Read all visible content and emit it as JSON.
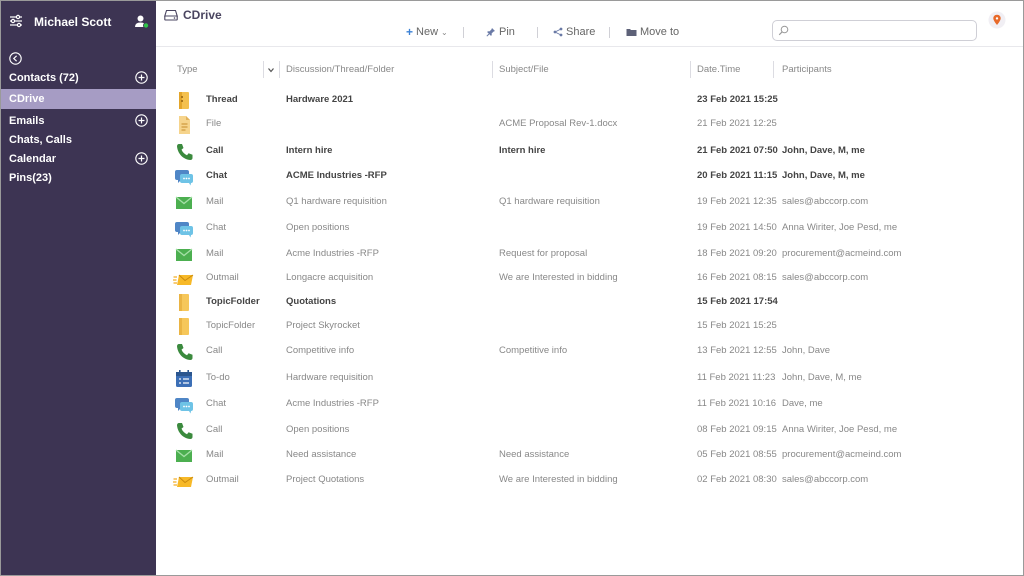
{
  "user": {
    "name": "Michael Scott"
  },
  "icons": {
    "settings": "settings-sliders-icon",
    "contact": "contact-status-icon",
    "back": "back-circle-icon",
    "add": "add-circle-icon",
    "drive": "drive-icon",
    "search": "search-icon"
  },
  "colors": {
    "sidebar_bg": "#3d3453",
    "sidebar_active": "#a69cc4",
    "status_online": "#2fc44a",
    "badge": "#e86a2a"
  },
  "sidebar": {
    "items": [
      {
        "label": "Contacts (72)",
        "add": true,
        "active": false
      },
      {
        "label": "CDrive",
        "add": false,
        "active": true
      },
      {
        "label": "Emails",
        "add": true,
        "active": false
      },
      {
        "label": "Chats, Calls",
        "add": false,
        "active": false
      },
      {
        "label": "Calendar",
        "add": true,
        "active": false
      },
      {
        "label": "Pins(23)",
        "add": false,
        "active": false
      }
    ]
  },
  "header": {
    "title": "CDrive",
    "toolbar": {
      "new": "New",
      "pin": "Pin",
      "share": "Share",
      "move": "Move to"
    },
    "search_placeholder": ""
  },
  "table": {
    "columns": {
      "type": "Type",
      "discussion": "Discussion/Thread/Folder",
      "subject": "Subject/File",
      "datetime": "Date.Time",
      "participants": "Participants"
    },
    "rows": [
      {
        "icon": "thread-folder-icon",
        "type": "Thread",
        "discussion": "Hardware 2021",
        "subject": "",
        "date": "23 Feb 2021 15:25",
        "participants": "",
        "bold": true
      },
      {
        "icon": "file-icon",
        "type": "File",
        "discussion": "",
        "subject": "ACME Proposal Rev-1.docx",
        "date": "21 Feb 2021 12:25",
        "participants": "",
        "bold": false
      },
      {
        "icon": "phone-icon",
        "type": "Call",
        "discussion": "Intern hire",
        "subject": "Intern hire",
        "date": "21 Feb 2021 07:50",
        "participants": "John, Dave, M, me",
        "bold": true
      },
      {
        "icon": "chat-icon",
        "type": "Chat",
        "discussion": "ACME Industries -RFP",
        "subject": "",
        "date": "20 Feb 2021 11:15",
        "participants": "John, Dave, M, me",
        "bold": true
      },
      {
        "icon": "mail-icon",
        "type": "Mail",
        "discussion": "Q1 hardware  requisition",
        "subject": "Q1 hardware  requisition",
        "date": "19 Feb 2021 12:35",
        "participants": "sales@abccorp.com",
        "bold": false
      },
      {
        "icon": "chat-icon",
        "type": "Chat",
        "discussion": "Open positions",
        "subject": "",
        "date": "19 Feb 2021 14:50",
        "participants": "Anna Wiriter, Joe Pesd, me",
        "bold": false
      },
      {
        "icon": "mail-icon",
        "type": "Mail",
        "discussion": "Acme Industries -RFP",
        "subject": "Request for proposal",
        "date": "18 Feb 2021 09:20",
        "participants": "procurement@acmeind.com",
        "bold": false
      },
      {
        "icon": "outmail-icon",
        "type": "Outmail",
        "discussion": "Longacre acquisition",
        "subject": "We are Interested in bidding",
        "date": "16 Feb 2021 08:15",
        "participants": "sales@abccorp.com",
        "bold": false
      },
      {
        "icon": "folder-icon",
        "type": "TopicFolder",
        "discussion": "Quotations",
        "subject": "",
        "date": "15 Feb 2021 17:54",
        "participants": "",
        "bold": true
      },
      {
        "icon": "folder-icon",
        "type": "TopicFolder",
        "discussion": "Project Skyrocket",
        "subject": "",
        "date": "15 Feb 2021 15:25",
        "participants": "",
        "bold": false
      },
      {
        "icon": "phone-icon",
        "type": "Call",
        "discussion": "Competitive info",
        "subject": "Competitive info",
        "date": "13 Feb 2021 12:55",
        "participants": "John, Dave",
        "bold": false
      },
      {
        "icon": "todo-icon",
        "type": "To-do",
        "discussion": "Hardware  requisition",
        "subject": "",
        "date": "11 Feb 2021 11:23",
        "participants": "John, Dave, M, me",
        "bold": false
      },
      {
        "icon": "chat-icon",
        "type": "Chat",
        "discussion": "Acme Industries -RFP",
        "subject": "",
        "date": "11 Feb 2021 10:16",
        "participants": "Dave, me",
        "bold": false
      },
      {
        "icon": "phone-icon",
        "type": "Call",
        "discussion": "Open positions",
        "subject": "",
        "date": "08 Feb 2021 09:15",
        "participants": "Anna Wiriter, Joe Pesd, me",
        "bold": false
      },
      {
        "icon": "mail-icon",
        "type": "Mail",
        "discussion": "Need assistance",
        "subject": "Need assistance",
        "date": "05 Feb 2021 08:55",
        "participants": "procurement@acmeind.com",
        "bold": false
      },
      {
        "icon": "outmail-icon",
        "type": "Outmail",
        "discussion": "Project Quotations",
        "subject": "We are Interested in bidding",
        "date": "02 Feb 2021 08:30",
        "participants": "sales@abccorp.com",
        "bold": false
      }
    ]
  }
}
